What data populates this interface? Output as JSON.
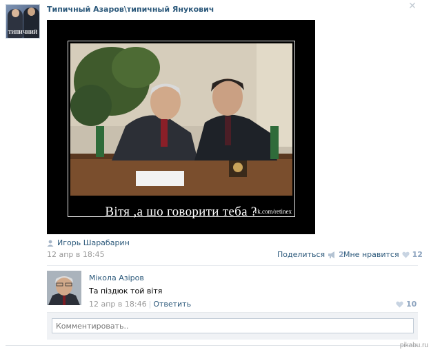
{
  "group": {
    "title": "Типичный Азаров\\типичный Янукович",
    "avatar_caption": "ТИПИЧНИЙ"
  },
  "post": {
    "demotivator_caption": "Вітя ,а шо говорити теба ?",
    "watermark": "vk.com/retinex",
    "author": "Игорь Шарабарин",
    "date": "12 апр в 18:45",
    "share_label": "Поделиться",
    "share_count": "2",
    "like_label": "Мне нравится",
    "like_count": "12"
  },
  "comment": {
    "author": "Мікола Азіров",
    "text": "Та піздюк той вітя",
    "date": "12 апр в 18:46",
    "separator": "|",
    "reply_label": "Ответить",
    "like_count": "10"
  },
  "comment_input": {
    "placeholder": "Комментировать.."
  },
  "footer": {
    "site": "pikabu.ru"
  },
  "icons": {
    "close": "close-icon",
    "user": "user-icon",
    "megaphone": "megaphone-icon",
    "heart": "heart-icon"
  },
  "colors": {
    "link": "#2b587a",
    "muted": "#999999",
    "count": "#8da4bf",
    "heart": "#c8d4e2"
  }
}
